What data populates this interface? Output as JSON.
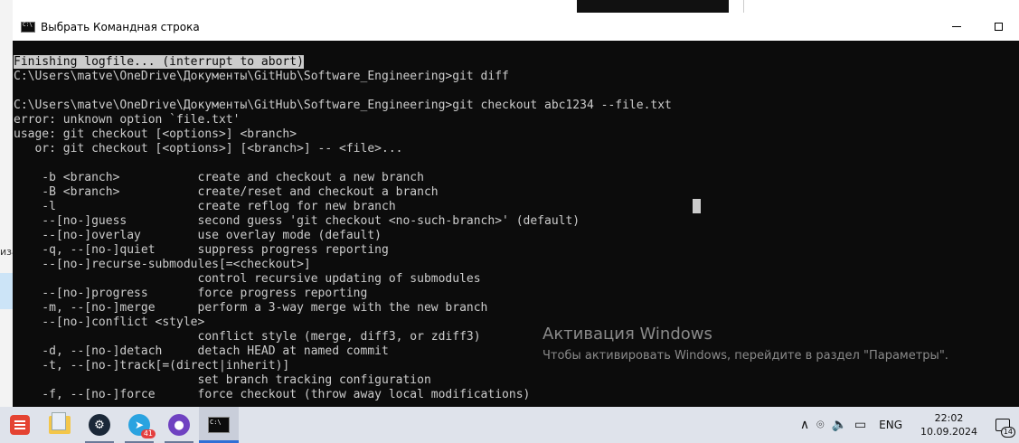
{
  "window": {
    "title": "Выбрать Командная строка",
    "minimize_icon": "minimize-icon",
    "maximize_icon": "maximize-icon"
  },
  "console": {
    "lines": [
      "Finishing logfile... (interrupt to abort)",
      "C:\\Users\\matve\\OneDrive\\Документы\\GitHub\\Software_Engineering>git diff",
      "",
      "C:\\Users\\matve\\OneDrive\\Документы\\GitHub\\Software_Engineering>git checkout abc1234 --file.txt",
      "error: unknown option `file.txt'",
      "usage: git checkout [<options>] <branch>",
      "   or: git checkout [<options>] [<branch>] -- <file>...",
      "",
      "    -b <branch>           create and checkout a new branch",
      "    -B <branch>           create/reset and checkout a branch",
      "    -l                    create reflog for new branch",
      "    --[no-]guess          second guess 'git checkout <no-such-branch>' (default)",
      "    --[no-]overlay        use overlay mode (default)",
      "    -q, --[no-]quiet      suppress progress reporting",
      "    --[no-]recurse-submodules[=<checkout>]",
      "                          control recursive updating of submodules",
      "    --[no-]progress       force progress reporting",
      "    -m, --[no-]merge      perform a 3-way merge with the new branch",
      "    --[no-]conflict <style>",
      "                          conflict style (merge, diff3, or zdiff3)",
      "    -d, --[no-]detach     detach HEAD at named commit",
      "    -t, --[no-]track[=(direct|inherit)]",
      "                          set branch tracking configuration",
      "    -f, --[no-]force      force checkout (throw away local modifications)"
    ],
    "selected_line_index": 0
  },
  "background": {
    "left_window_fragment": "иза"
  },
  "watermark": {
    "title": "Активация Windows",
    "subtitle": "Чтобы активировать Windows, перейдите в раздел \"Параметры\"."
  },
  "taskbar": {
    "apps": [
      {
        "name": "todoist-icon",
        "running": false
      },
      {
        "name": "file-explorer-icon",
        "running": false
      },
      {
        "name": "steam-icon",
        "running": true
      },
      {
        "name": "telegram-icon",
        "running": true,
        "badge": "41"
      },
      {
        "name": "github-desktop-icon",
        "running": true
      },
      {
        "name": "command-prompt-icon",
        "running": true,
        "active": true
      }
    ],
    "tray": {
      "chevron_icon": "chevron-up-icon",
      "meet_icon": "camera-icon",
      "volume_icon": "volume-icon",
      "network_icon": "network-icon",
      "language": "ENG",
      "time": "22:02",
      "date": "10.09.2024",
      "notification_count": "14"
    }
  },
  "colors": {
    "console_bg": "#0c0c0c",
    "console_fg": "#cccccc",
    "taskbar_bg": "#dfe3eb",
    "active_indicator": "#2f6fd6"
  }
}
